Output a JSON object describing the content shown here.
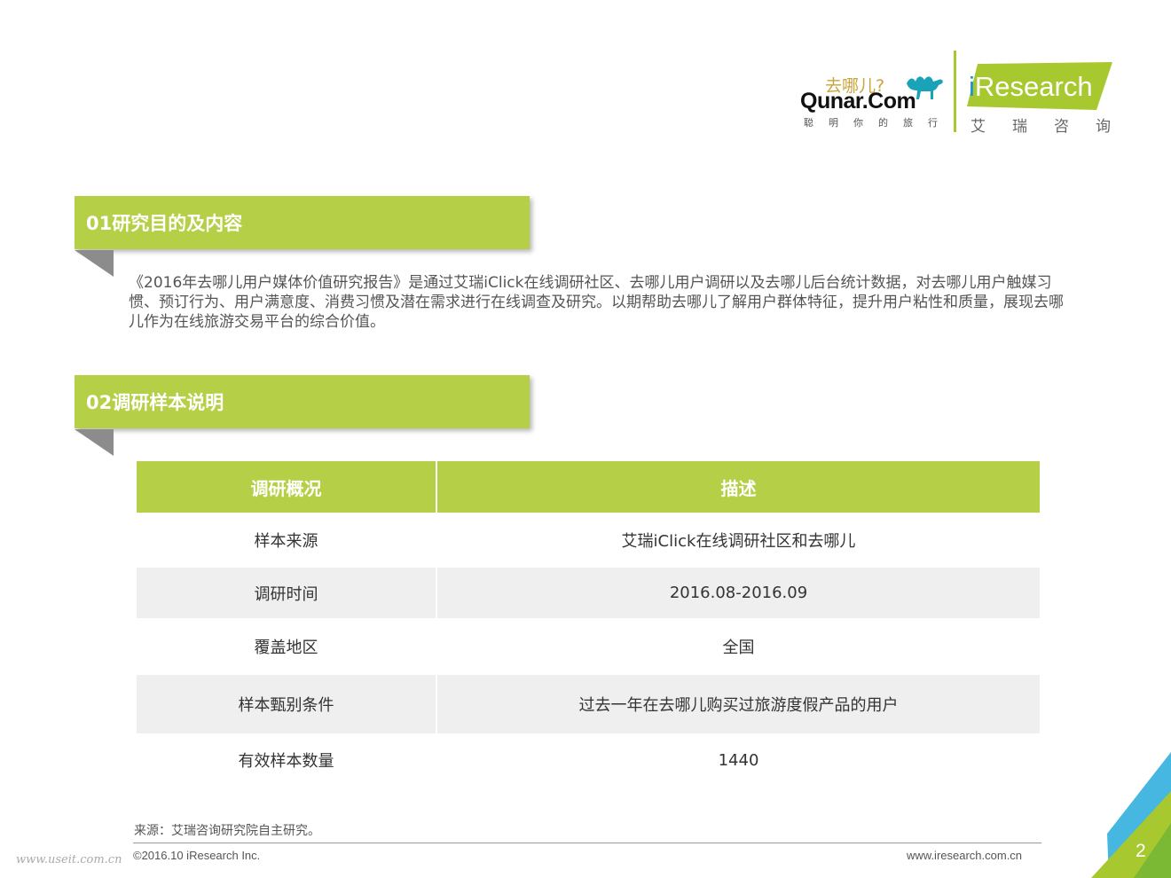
{
  "logos": {
    "qunar_cn": "去哪儿?",
    "qunar_en": "Qunar.Com",
    "qunar_slogan": "聪明你的旅行",
    "iresearch_en_i": "i",
    "iresearch_en_rest": "Research",
    "iresearch_cn": "艾瑞咨询"
  },
  "section1": {
    "title": "01研究目的及内容",
    "body": "《2016年去哪儿用户媒体价值研究报告》是通过艾瑞iClick在线调研社区、去哪儿用户调研以及去哪儿后台统计数据，对去哪儿用户触媒习惯、预订行为、用户满意度、消费习惯及潜在需求进行在线调查及研究。以期帮助去哪儿了解用户群体特征，提升用户粘性和质量，展现去哪儿作为在线旅游交易平台的综合价值。"
  },
  "section2": {
    "title": "02调研样本说明",
    "table": {
      "headers": [
        "调研概况",
        "描述"
      ],
      "rows": [
        [
          "样本来源",
          "艾瑞iClick在线调研社区和去哪儿"
        ],
        [
          "调研时间",
          "2016.08-2016.09"
        ],
        [
          "覆盖地区",
          "全国"
        ],
        [
          "样本甄别条件",
          "过去一年在去哪儿购买过旅游度假产品的用户"
        ],
        [
          "有效样本数量",
          "1440"
        ]
      ]
    }
  },
  "footer": {
    "source": "来源：艾瑞咨询研究院自主研究。",
    "copyright": "©2016.10 iResearch Inc.",
    "website": "www.iresearch.com.cn",
    "page_number": "2",
    "watermark": "www.useit.com.cn"
  },
  "colors": {
    "accent_green": "#b5d046",
    "alt_row": "#efefef",
    "iresearch_blue": "#1b93d5"
  }
}
